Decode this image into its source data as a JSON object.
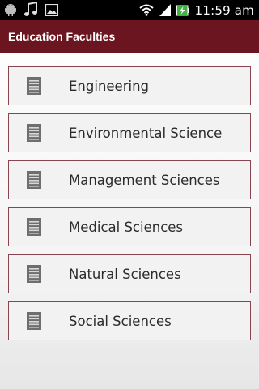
{
  "status_bar": {
    "time": "11:59 am",
    "left_icons": [
      "android-debug-icon",
      "music-note-icon",
      "image-icon"
    ],
    "right_icons": [
      "wifi-icon",
      "signal-icon",
      "battery-charging-icon"
    ]
  },
  "app": {
    "title": "Education Faculties",
    "title_bar_color": "#6b1520"
  },
  "faculties": {
    "items": [
      {
        "label": "Engineering",
        "icon": "document-icon"
      },
      {
        "label": "Environmental Science",
        "icon": "document-icon"
      },
      {
        "label": "Management Sciences",
        "icon": "document-icon"
      },
      {
        "label": "Medical Sciences",
        "icon": "document-icon"
      },
      {
        "label": "Natural Sciences",
        "icon": "document-icon"
      },
      {
        "label": "Social Sciences",
        "icon": "document-icon"
      }
    ]
  },
  "colors": {
    "item_border": "#8a4450",
    "item_background": "#f2f2f2",
    "icon_color": "#6e6e6e"
  }
}
